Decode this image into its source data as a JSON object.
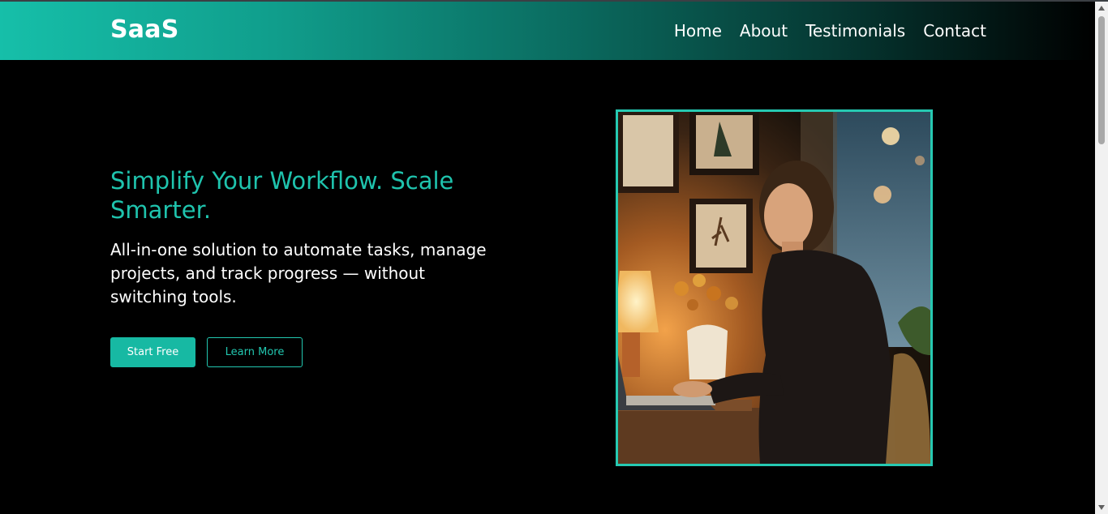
{
  "brand": "SaaS",
  "nav": [
    {
      "label": "Home"
    },
    {
      "label": "About"
    },
    {
      "label": "Testimonials"
    },
    {
      "label": "Contact"
    }
  ],
  "hero": {
    "title": "Simplify Your Workflow. Scale Smarter.",
    "subtitle": "All-in-one solution to automate tasks, manage projects, and track progress — without switching tools.",
    "primary_button": "Start Free",
    "secondary_button": "Learn More"
  },
  "colors": {
    "accent": "#1fc3ad",
    "background": "#000000",
    "frame_border": "#26c9b2"
  },
  "icons": {
    "scroll_up": "triangle-up-icon",
    "scroll_down": "triangle-down-icon"
  }
}
